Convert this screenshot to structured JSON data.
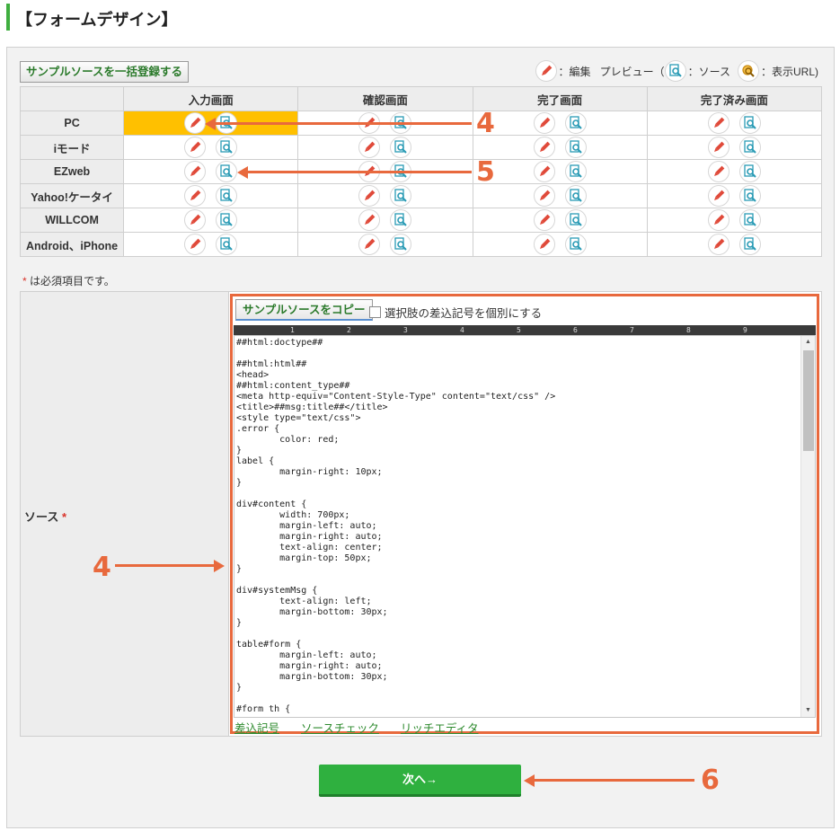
{
  "page": {
    "title": "【フォームデザイン】"
  },
  "toolbar": {
    "bulk_register_label": "サンプルソースを一括登録する"
  },
  "legend": {
    "edit_label": "：編集",
    "preview_label": "プレビュー（",
    "source_label": "：ソース",
    "url_label": "：表示URL)"
  },
  "grid": {
    "columns": [
      "入力画面",
      "確認画面",
      "完了画面",
      "完了済み画面"
    ],
    "rows": [
      "PC",
      "iモード",
      "EZweb",
      "Yahoo!ケータイ",
      "WILLCOM",
      "Android、iPhone"
    ]
  },
  "note": {
    "asterisk": "*",
    "text": " は必須項目です。"
  },
  "source": {
    "label": "ソース",
    "required_mark": "*",
    "copy_button": "サンプルソースをコピー",
    "checkbox_label": "選択肢の差込記号を個別にする",
    "ruler_ticks": [
      "1",
      "2",
      "3",
      "4",
      "5",
      "6",
      "7",
      "8",
      "9"
    ],
    "code": "##html:doctype##\n\n##html:html##\n<head>\n##html:content_type##\n<meta http-equiv=\"Content-Style-Type\" content=\"text/css\" />\n<title>##msg:title##</title>\n<style type=\"text/css\">\n.error {\n        color: red;\n}\nlabel {\n        margin-right: 10px;\n}\n\ndiv#content {\n        width: 700px;\n        margin-left: auto;\n        margin-right: auto;\n        text-align: center;\n        margin-top: 50px;\n}\n\ndiv#systemMsg {\n        text-align: left;\n        margin-bottom: 30px;\n}\n\ntable#form {\n        margin-left: auto;\n        margin-right: auto;\n        margin-bottom: 30px;\n}\n\n#form th {",
    "links": [
      "差込記号",
      "ソースチェック",
      "リッチエディタ"
    ]
  },
  "next_button": {
    "label": "次へ→"
  },
  "annotations": {
    "a4": "4",
    "a5": "5",
    "a4b": "4",
    "a6": "6"
  },
  "colors": {
    "accent": "#e8693d",
    "highlight": "#ffc000",
    "primary": "#2fb03f"
  }
}
